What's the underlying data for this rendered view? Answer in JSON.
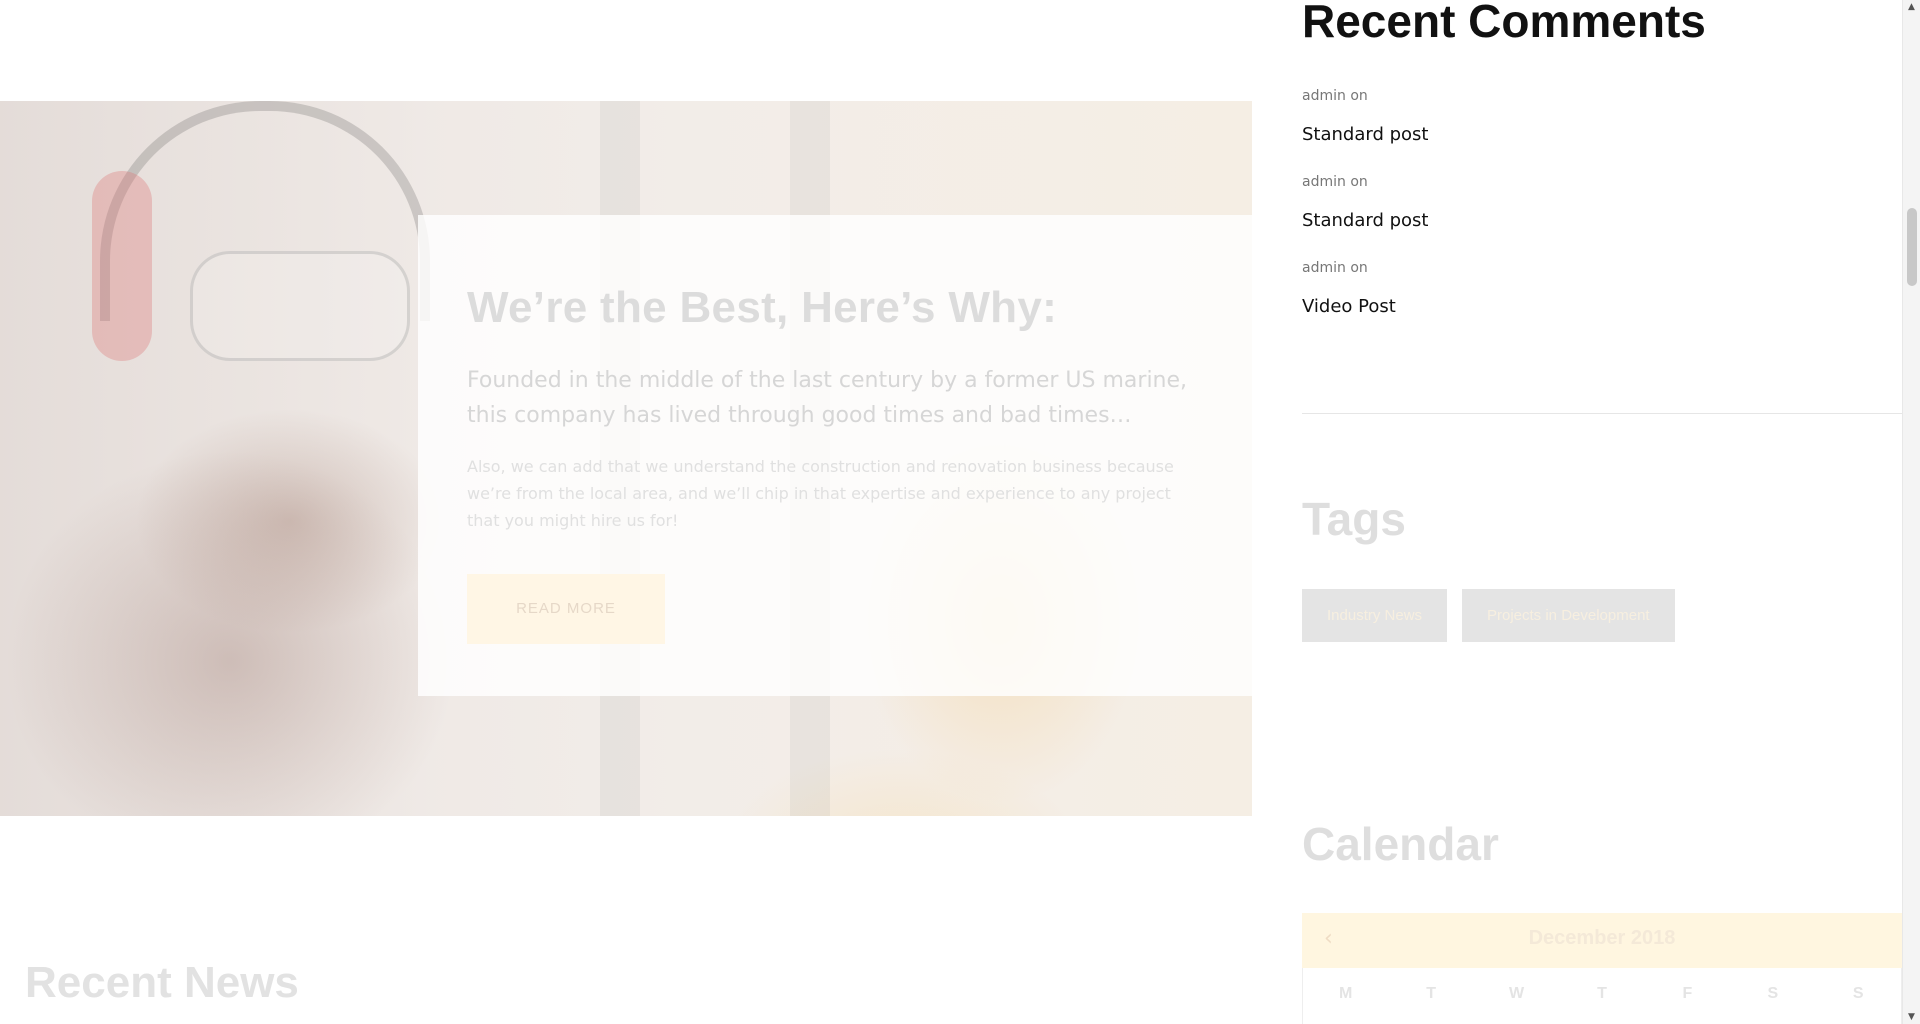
{
  "hero": {
    "title": "We’re the Best, Here’s Why:",
    "lead": "Founded in the middle of the last century by a former US marine, this company has lived through good times and bad times…",
    "body": "Also, we can add that we understand the construction and renovation business because we’re from the local area, and we’ll chip in that expertise and experience to any project that you might hire us for!",
    "button_label": "READ MORE"
  },
  "recent_news": {
    "title": "Recent News"
  },
  "sidebar": {
    "recent_comments": {
      "title": "Recent Comments",
      "items": [
        {
          "author": "admin",
          "on": "on",
          "post": "Standard post"
        },
        {
          "author": "admin",
          "on": "on",
          "post": "Standard post"
        },
        {
          "author": "admin",
          "on": "on",
          "post": "Video Post"
        }
      ]
    },
    "tags": {
      "title": "Tags",
      "items": [
        "Industry News",
        "Projects in Development"
      ]
    },
    "calendar": {
      "title": "Calendar",
      "month": "December 2018",
      "prev_icon": "chevron-left-icon",
      "weekdays": [
        "M",
        "T",
        "W",
        "T",
        "F",
        "S",
        "S"
      ]
    }
  },
  "colors": {
    "accent": "#fff6e0",
    "tag_bg": "#e4e4e4",
    "heading": "#111111"
  }
}
